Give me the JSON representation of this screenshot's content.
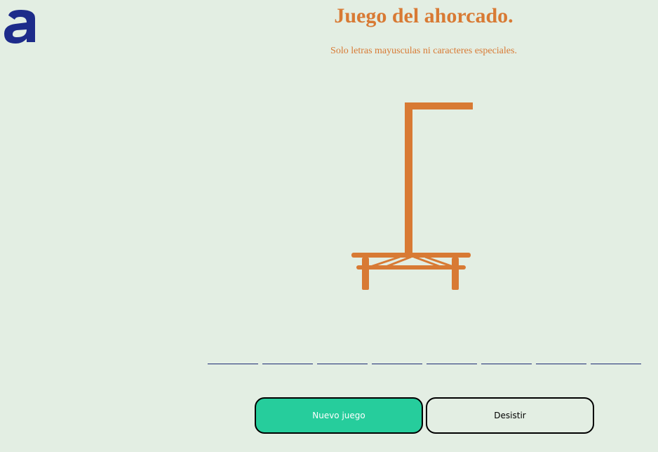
{
  "logo": {
    "icon": "alura-logo-icon",
    "color": "#1d2b8a"
  },
  "header": {
    "title": "Juego del ahorcado.",
    "subtitle": "Solo letras mayusculas ni caracteres especiales."
  },
  "gallows": {
    "icon": "gallows-icon",
    "color": "#d87a34"
  },
  "word": {
    "letters": [
      "",
      "",
      "",
      "",
      "",
      "",
      "",
      ""
    ]
  },
  "buttons": {
    "new_game": "Nuevo juego",
    "give_up": "Desistir"
  },
  "colors": {
    "background": "#e3eee3",
    "accent": "#d87a34",
    "primary_button": "#26cd9c",
    "line": "#1d2b73"
  }
}
